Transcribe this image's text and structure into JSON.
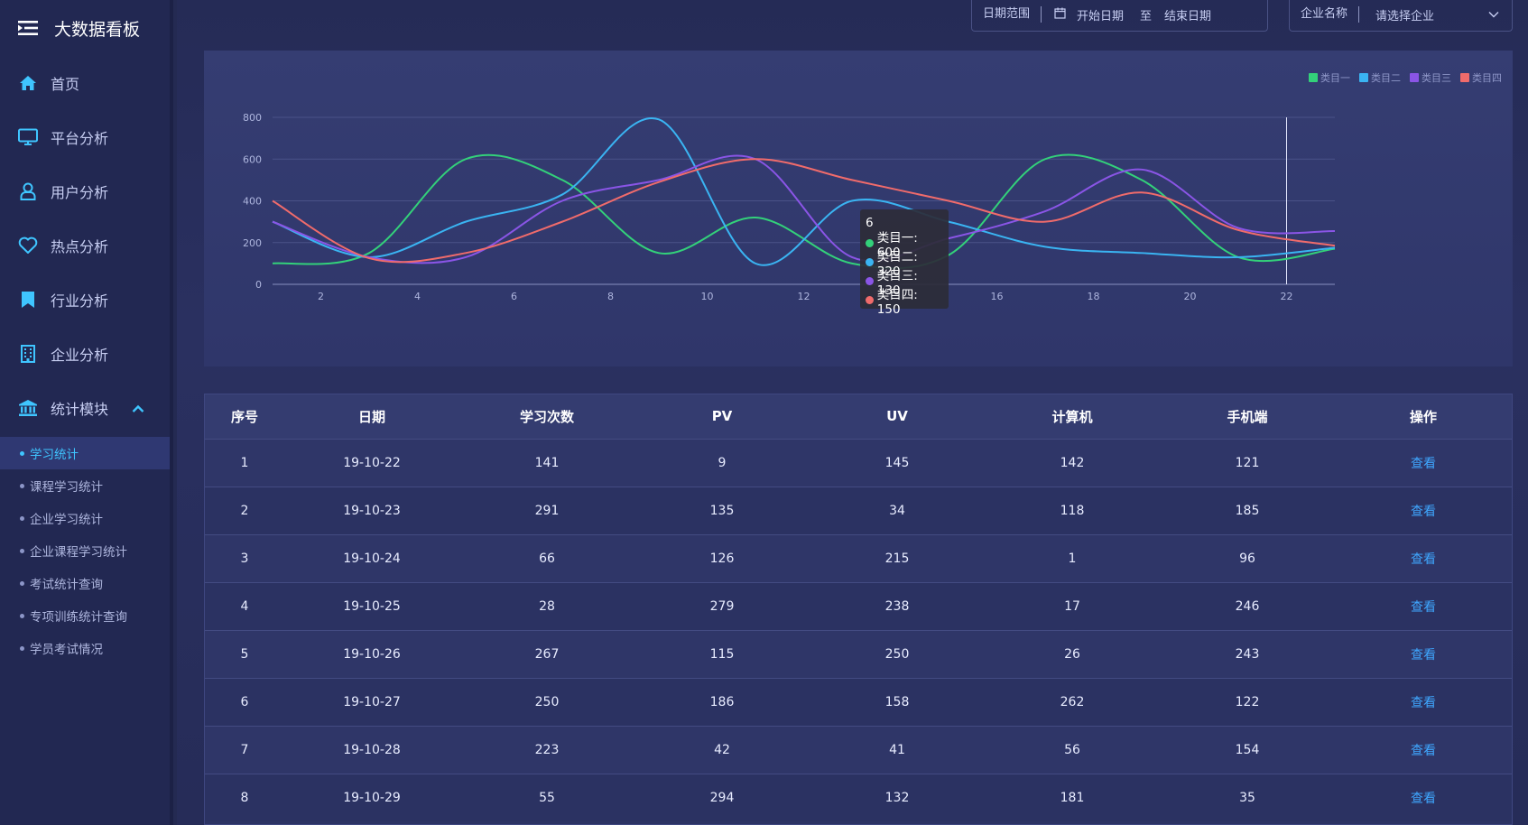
{
  "brand": {
    "title": "大数据看板"
  },
  "sidebar": {
    "items": [
      {
        "label": "首页",
        "icon": "home-icon"
      },
      {
        "label": "平台分析",
        "icon": "monitor-icon"
      },
      {
        "label": "用户分析",
        "icon": "user-icon"
      },
      {
        "label": "热点分析",
        "icon": "heart-icon"
      },
      {
        "label": "行业分析",
        "icon": "bookmark-icon"
      },
      {
        "label": "企业分析",
        "icon": "building-icon"
      },
      {
        "label": "统计模块",
        "icon": "bank-icon"
      }
    ],
    "sub_items": [
      {
        "label": "学习统计",
        "active": true
      },
      {
        "label": "课程学习统计"
      },
      {
        "label": "企业学习统计"
      },
      {
        "label": "企业课程学习统计"
      },
      {
        "label": "考试统计查询"
      },
      {
        "label": "专项训练统计查询"
      },
      {
        "label": "学员考试情况"
      }
    ]
  },
  "filters": {
    "date_label": "日期范围",
    "start_placeholder": "开始日期",
    "separator": "至",
    "end_placeholder": "结束日期",
    "company_label": "企业名称",
    "company_placeholder": "请选择企业"
  },
  "chart_data": {
    "type": "line",
    "smooth": true,
    "x": [
      2,
      4,
      6,
      8,
      10,
      12,
      14,
      16,
      18,
      20,
      22
    ],
    "xlim": [
      1,
      23
    ],
    "ylim": [
      0,
      800
    ],
    "yticks": [
      0,
      200,
      400,
      600,
      800
    ],
    "xticks": [
      2,
      4,
      6,
      8,
      10,
      12,
      14,
      16,
      18,
      20,
      22
    ],
    "grid": true,
    "legend": "top-right",
    "series": [
      {
        "name": "类目一",
        "color": "#33d17a",
        "points": [
          [
            1,
            100
          ],
          [
            3,
            150
          ],
          [
            5,
            600
          ],
          [
            7,
            500
          ],
          [
            9,
            150
          ],
          [
            11,
            320
          ],
          [
            13,
            100
          ],
          [
            15,
            140
          ],
          [
            17,
            600
          ],
          [
            19,
            500
          ],
          [
            21,
            130
          ],
          [
            23,
            170
          ]
        ]
      },
      {
        "name": "类目二",
        "color": "#3ab4f2",
        "points": [
          [
            1,
            300
          ],
          [
            3,
            130
          ],
          [
            5,
            300
          ],
          [
            7,
            430
          ],
          [
            9,
            790
          ],
          [
            11,
            100
          ],
          [
            13,
            400
          ],
          [
            15,
            300
          ],
          [
            17,
            180
          ],
          [
            19,
            150
          ],
          [
            21,
            130
          ],
          [
            23,
            175
          ]
        ]
      },
      {
        "name": "类目三",
        "color": "#8a55e6",
        "points": [
          [
            1,
            300
          ],
          [
            3,
            130
          ],
          [
            5,
            130
          ],
          [
            7,
            400
          ],
          [
            9,
            500
          ],
          [
            11,
            600
          ],
          [
            13,
            130
          ],
          [
            15,
            220
          ],
          [
            17,
            350
          ],
          [
            19,
            550
          ],
          [
            21,
            270
          ],
          [
            23,
            255
          ]
        ]
      },
      {
        "name": "类目四",
        "color": "#f06b6b",
        "points": [
          [
            1,
            400
          ],
          [
            3,
            125
          ],
          [
            5,
            150
          ],
          [
            7,
            300
          ],
          [
            9,
            490
          ],
          [
            11,
            600
          ],
          [
            13,
            500
          ],
          [
            15,
            400
          ],
          [
            17,
            300
          ],
          [
            19,
            440
          ],
          [
            21,
            260
          ],
          [
            23,
            185
          ]
        ]
      }
    ],
    "cursor_x": 22,
    "tooltip": {
      "title": "6",
      "rows": [
        {
          "name": "类目一",
          "value": 600
        },
        {
          "name": "类目二",
          "value": 320
        },
        {
          "name": "类目三",
          "value": 130
        },
        {
          "name": "类目四",
          "value": 150
        }
      ]
    }
  },
  "tooltip_lines": {
    "title": "6",
    "r0": "类目一: 600",
    "r1": "类目二: 320",
    "r2": "类目三: 130",
    "r3": "类目四: 150"
  },
  "table": {
    "headers": [
      "序号",
      "日期",
      "学习次数",
      "PV",
      "UV",
      "计算机",
      "手机端",
      "操作"
    ],
    "action_label": "查看",
    "rows": [
      [
        "1",
        "19-10-22",
        "141",
        "9",
        "145",
        "142",
        "121"
      ],
      [
        "2",
        "19-10-23",
        "291",
        "135",
        "34",
        "118",
        "185"
      ],
      [
        "3",
        "19-10-24",
        "66",
        "126",
        "215",
        "1",
        "96"
      ],
      [
        "4",
        "19-10-25",
        "28",
        "279",
        "238",
        "17",
        "246"
      ],
      [
        "5",
        "19-10-26",
        "267",
        "115",
        "250",
        "26",
        "243"
      ],
      [
        "6",
        "19-10-27",
        "250",
        "186",
        "158",
        "262",
        "122"
      ],
      [
        "7",
        "19-10-28",
        "223",
        "42",
        "41",
        "56",
        "154"
      ],
      [
        "8",
        "19-10-29",
        "55",
        "294",
        "132",
        "181",
        "35"
      ]
    ]
  }
}
